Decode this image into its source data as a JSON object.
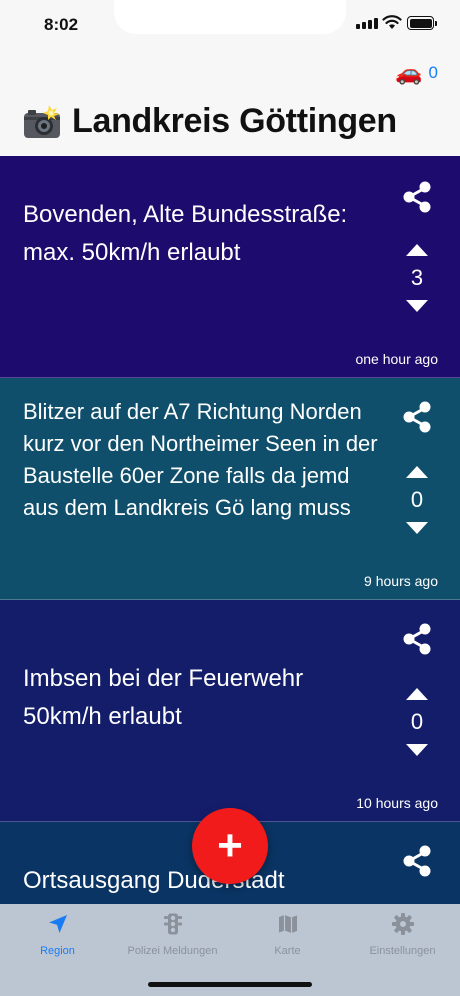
{
  "status_bar": {
    "time": "8:02"
  },
  "header": {
    "car_emoji": "🚗",
    "counter": "0",
    "title": "Landkreis Göttingen",
    "icon": "camera-flash-icon"
  },
  "posts": [
    {
      "text": "Bovenden, Alte Bundesstraße: max. 50km/h erlaubt",
      "votes": "3",
      "age": "one hour ago",
      "color": "#1e0b6e"
    },
    {
      "text": "Blitzer auf der A7 Richtung Norden kurz vor den Northeimer Seen in der Baustelle 60er Zone falls da jemd aus dem Landkreis Gö lang muss",
      "votes": "0",
      "age": "9 hours ago",
      "color": "#0f4f6b"
    },
    {
      "text": "Imbsen bei der Feuerwehr 50km/h erlaubt",
      "votes": "0",
      "age": "10 hours ago",
      "color": "#141d6a"
    },
    {
      "text": "Ortsausgang Duderstadt",
      "color": "#0a3463"
    }
  ],
  "fab": {
    "label": "+"
  },
  "tabs": [
    {
      "label": "Region",
      "icon": "location-arrow-icon",
      "active": true
    },
    {
      "label": "Polizei Meldungen",
      "icon": "traffic-light-icon",
      "active": false
    },
    {
      "label": "Karte",
      "icon": "map-icon",
      "active": false
    },
    {
      "label": "Einstellungen",
      "icon": "gear-icon",
      "active": false
    }
  ],
  "colors": {
    "accent": "#1a7cf5",
    "fab": "#f21b1b",
    "tab_bar": "#bcc6d3"
  }
}
